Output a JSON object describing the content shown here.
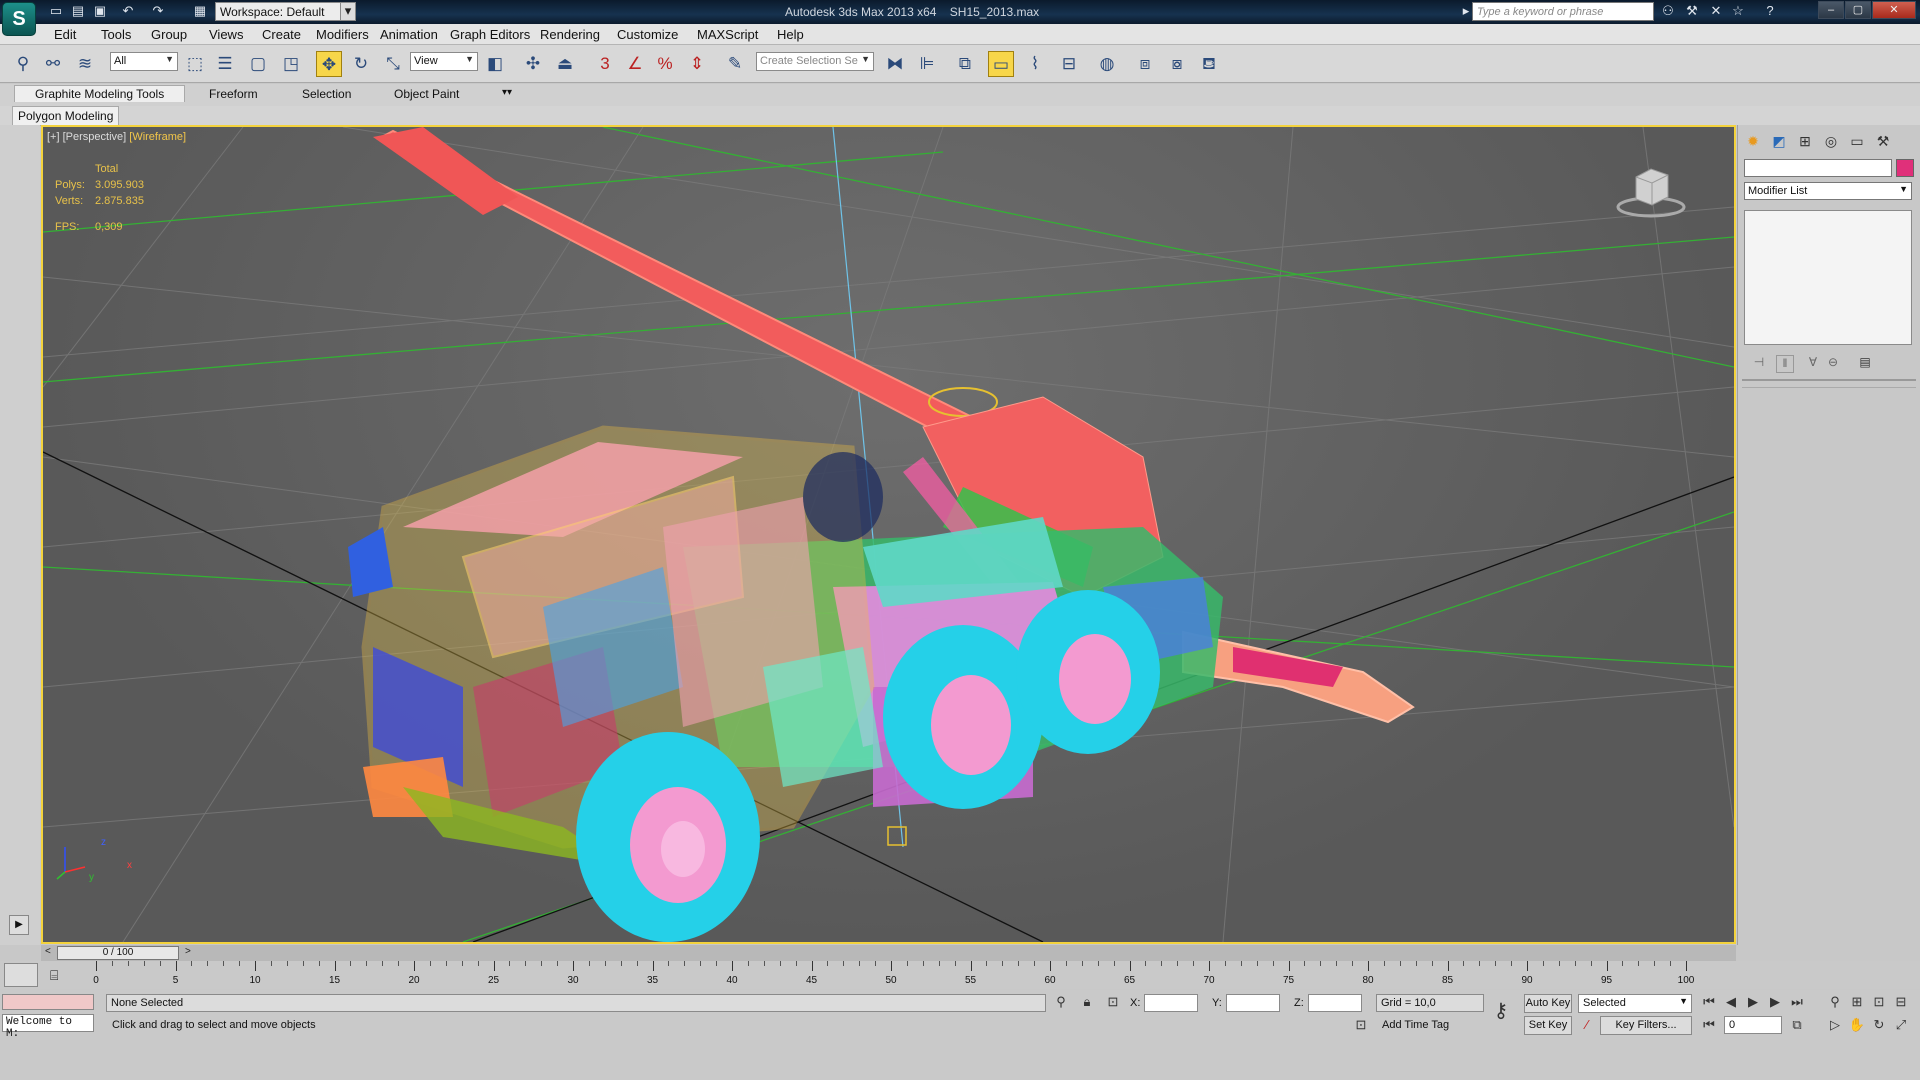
{
  "title": {
    "app": "Autodesk 3ds Max  2013 x64",
    "file": "SH15_2013.max"
  },
  "workspace": "Workspace: Default",
  "search_placeholder": "Type a keyword or phrase",
  "menu": [
    "Edit",
    "Tools",
    "Group",
    "Views",
    "Create",
    "Modifiers",
    "Animation",
    "Graph Editors",
    "Rendering",
    "Customize",
    "MAXScript",
    "Help"
  ],
  "toolbar": {
    "selection_filter": "All",
    "ref_coord": "View",
    "named_selection": "Create Selection Se",
    "snap_labels": [
      "3",
      "%"
    ]
  },
  "ribbon": {
    "tabs": [
      "Graphite Modeling Tools",
      "Freeform",
      "Selection",
      "Object Paint"
    ],
    "sub": "Polygon Modeling"
  },
  "viewport": {
    "label_plus": "[+]",
    "label_view": "[Perspective]",
    "label_shade": "[Wireframe]",
    "stats_total": "Total",
    "polys_label": "Polys:",
    "polys_value": "3.095.903",
    "verts_label": "Verts:",
    "verts_value": "2.875.835",
    "fps_label": "FPS:",
    "fps_value": "0,309",
    "axis_z": "z",
    "axis_x": "x",
    "axis_y": "y"
  },
  "command_panel": {
    "modifier_list": "Modifier List"
  },
  "time": {
    "slider": "0 / 100",
    "ticks": [
      "0",
      "5",
      "10",
      "15",
      "20",
      "25",
      "30",
      "35",
      "40",
      "45",
      "50",
      "55",
      "60",
      "65",
      "70",
      "75",
      "80",
      "85",
      "90",
      "95",
      "100"
    ]
  },
  "status": {
    "maxscript": "Welcome to M:",
    "selection": "None Selected",
    "prompt": "Click and drag to select and move objects",
    "x_label": "X:",
    "y_label": "Y:",
    "z_label": "Z:",
    "grid": "Grid = 10,0",
    "add_time_tag": "Add Time Tag",
    "auto_key": "Auto Key",
    "set_key": "Set Key",
    "key_mode": "Selected",
    "key_filters": "Key Filters...",
    "frame": "0"
  }
}
